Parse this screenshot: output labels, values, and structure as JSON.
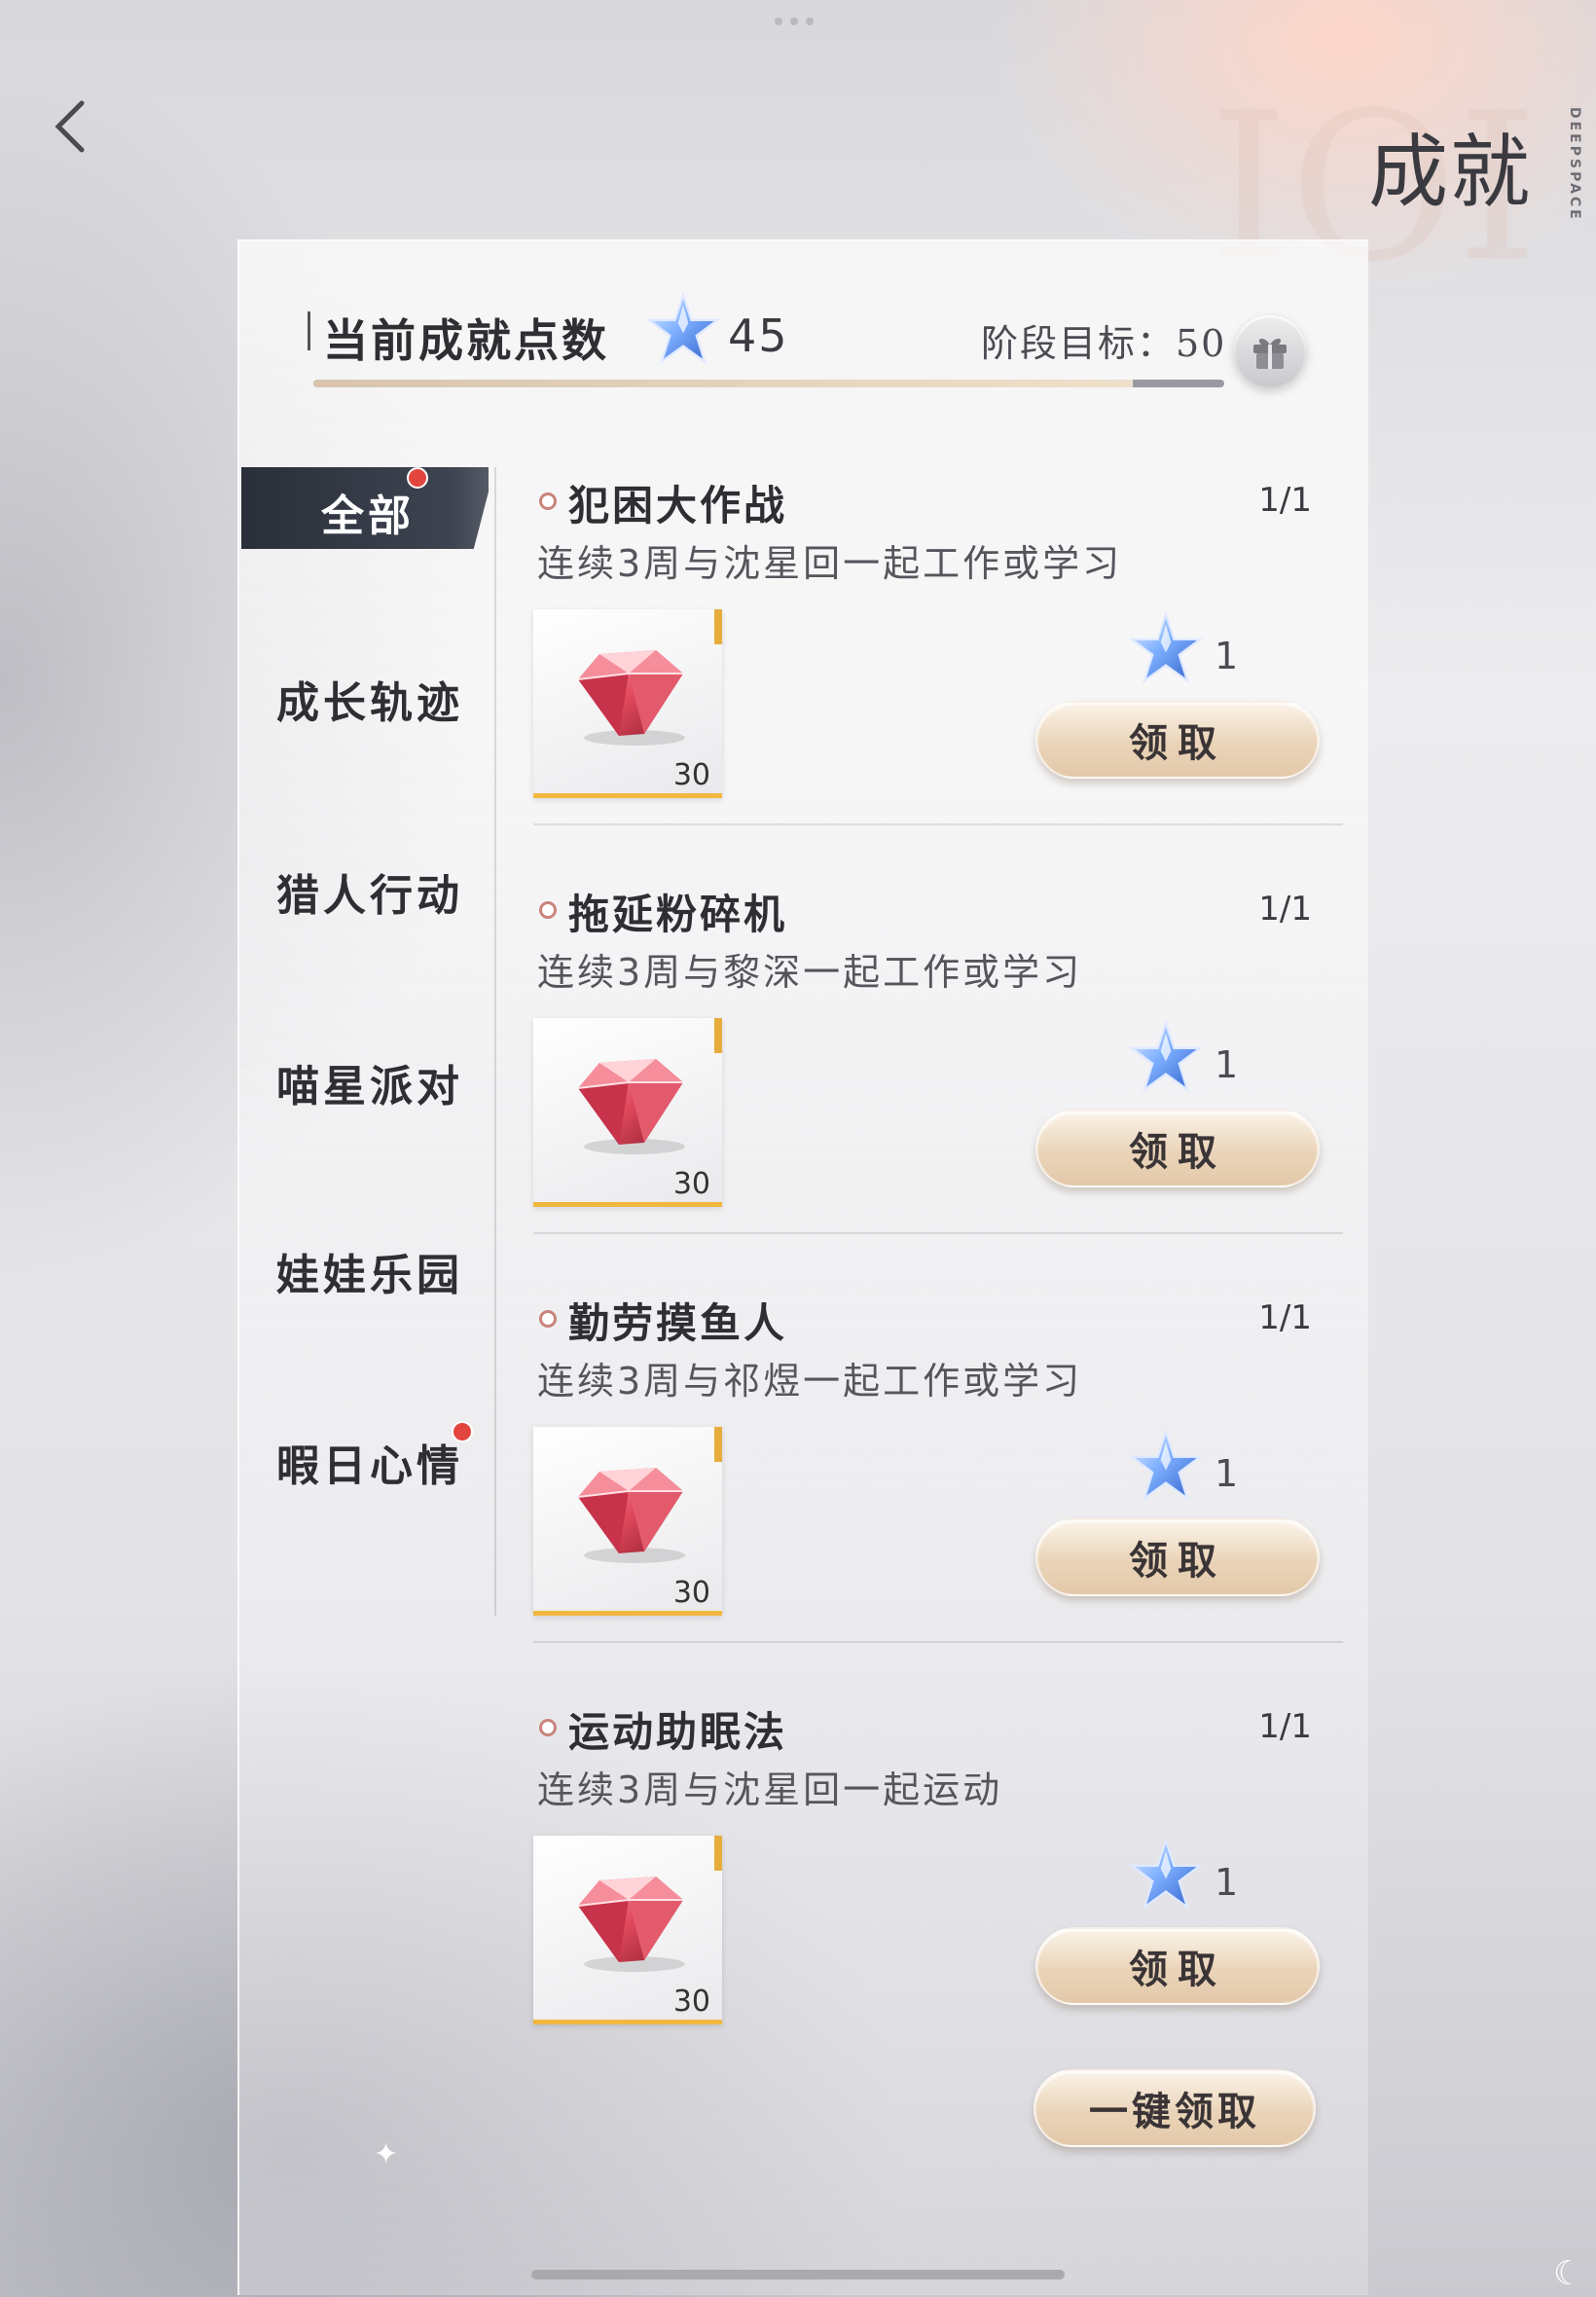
{
  "header": {
    "title": "成就",
    "brand": "DEEPSPACE",
    "points_label": "当前成就点数",
    "points": "45",
    "goal_text": "阶段目标：50",
    "progress_fraction": 0.9
  },
  "sidebar": {
    "items": [
      {
        "label": "全部",
        "selected": true,
        "badge": true
      },
      {
        "label": "成长轨迹",
        "selected": false,
        "badge": false
      },
      {
        "label": "猎人行动",
        "selected": false,
        "badge": false
      },
      {
        "label": "喵星派对",
        "selected": false,
        "badge": false
      },
      {
        "label": "娃娃乐园",
        "selected": false,
        "badge": false
      },
      {
        "label": "暇日心情",
        "selected": false,
        "badge": true
      }
    ]
  },
  "achievements": [
    {
      "name": "犯困大作战",
      "progress": "1/1",
      "desc": "连续3周与沈星回一起工作或学习",
      "reward_qty": "30",
      "star_reward": "1",
      "button": "领取"
    },
    {
      "name": "拖延粉碎机",
      "progress": "1/1",
      "desc": "连续3周与黎深一起工作或学习",
      "reward_qty": "30",
      "star_reward": "1",
      "button": "领取"
    },
    {
      "name": "勤劳摸鱼人",
      "progress": "1/1",
      "desc": "连续3周与祁煜一起工作或学习",
      "reward_qty": "30",
      "star_reward": "1",
      "button": "领取"
    },
    {
      "name": "运动助眠法",
      "progress": "1/1",
      "desc": "连续3周与沈星回一起运动",
      "reward_qty": "30",
      "star_reward": "1",
      "button": "领取"
    }
  ],
  "claim_all_label": "一键领取",
  "icons": {
    "back": "chevron-left-icon",
    "star": "blue-star-icon",
    "gift": "gift-icon",
    "gem": "red-diamond-icon"
  },
  "colors": {
    "accent_button": "#e9d3b6",
    "badge_red": "#e2453d",
    "selected_tab": "#2f343f",
    "star_blue": "#5b8fe6",
    "gem_red": "#e34a5e"
  }
}
